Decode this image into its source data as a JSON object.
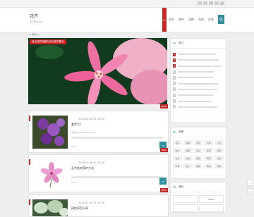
{
  "header": {
    "logo_text": "花卉",
    "tagline": "花卉知识大全"
  },
  "nav": {
    "home": "≡",
    "items": [
      "花卉",
      "养护",
      "品种",
      "百科",
      "问答"
    ],
    "search_icon": "search-icon"
  },
  "breadcrumb": "⌂ 首页 >",
  "hero": {
    "caption": "百合花的种植方法与养护要点"
  },
  "posts": [
    {
      "badge": "NEW",
      "meta": "2025-04-06 11:36:00",
      "title": "紫罗兰?",
      "excerpt": "紫罗兰 Matthiola incana",
      "views": "24 ℃",
      "more_icon": "list-icon"
    },
    {
      "badge": "NEW",
      "meta": "2025-04-06 11:34:00",
      "title": "石竹花的养护方法",
      "excerpt": "",
      "views": "24 ℃",
      "more_icon": "list-icon"
    },
    {
      "badge": "NEW",
      "meta": "2025-04-06 11:31:00",
      "title": "网纹草怎么养",
      "excerpt": "",
      "views": "",
      "more_icon": "list-icon"
    }
  ],
  "sidebar": {
    "hot": {
      "title": "热门",
      "ranks": [
        "1",
        "2",
        "3",
        "4",
        "5",
        "6",
        "7",
        "8",
        "9",
        "10"
      ]
    },
    "tags": {
      "title": "标签",
      "items": [
        "花卉",
        "盆栽",
        "百合",
        "月季",
        "兰花",
        "多肉",
        "绿萝",
        "吊兰",
        "茉莉",
        "菊花",
        "牡丹",
        "杜鹃",
        "桂花",
        "荷花",
        "水仙",
        "芦荟",
        "仙人",
        "玫瑰",
        "郁金",
        "茶花",
        "海棠",
        "风信",
        "君子",
        "富贵",
        "发财"
      ]
    },
    "stats": {
      "title": "统计",
      "cells": [
        "",
        "30501",
        "",
        ""
      ]
    }
  },
  "colors": {
    "accent": "#c62828",
    "teal": "#2f8f9d"
  }
}
